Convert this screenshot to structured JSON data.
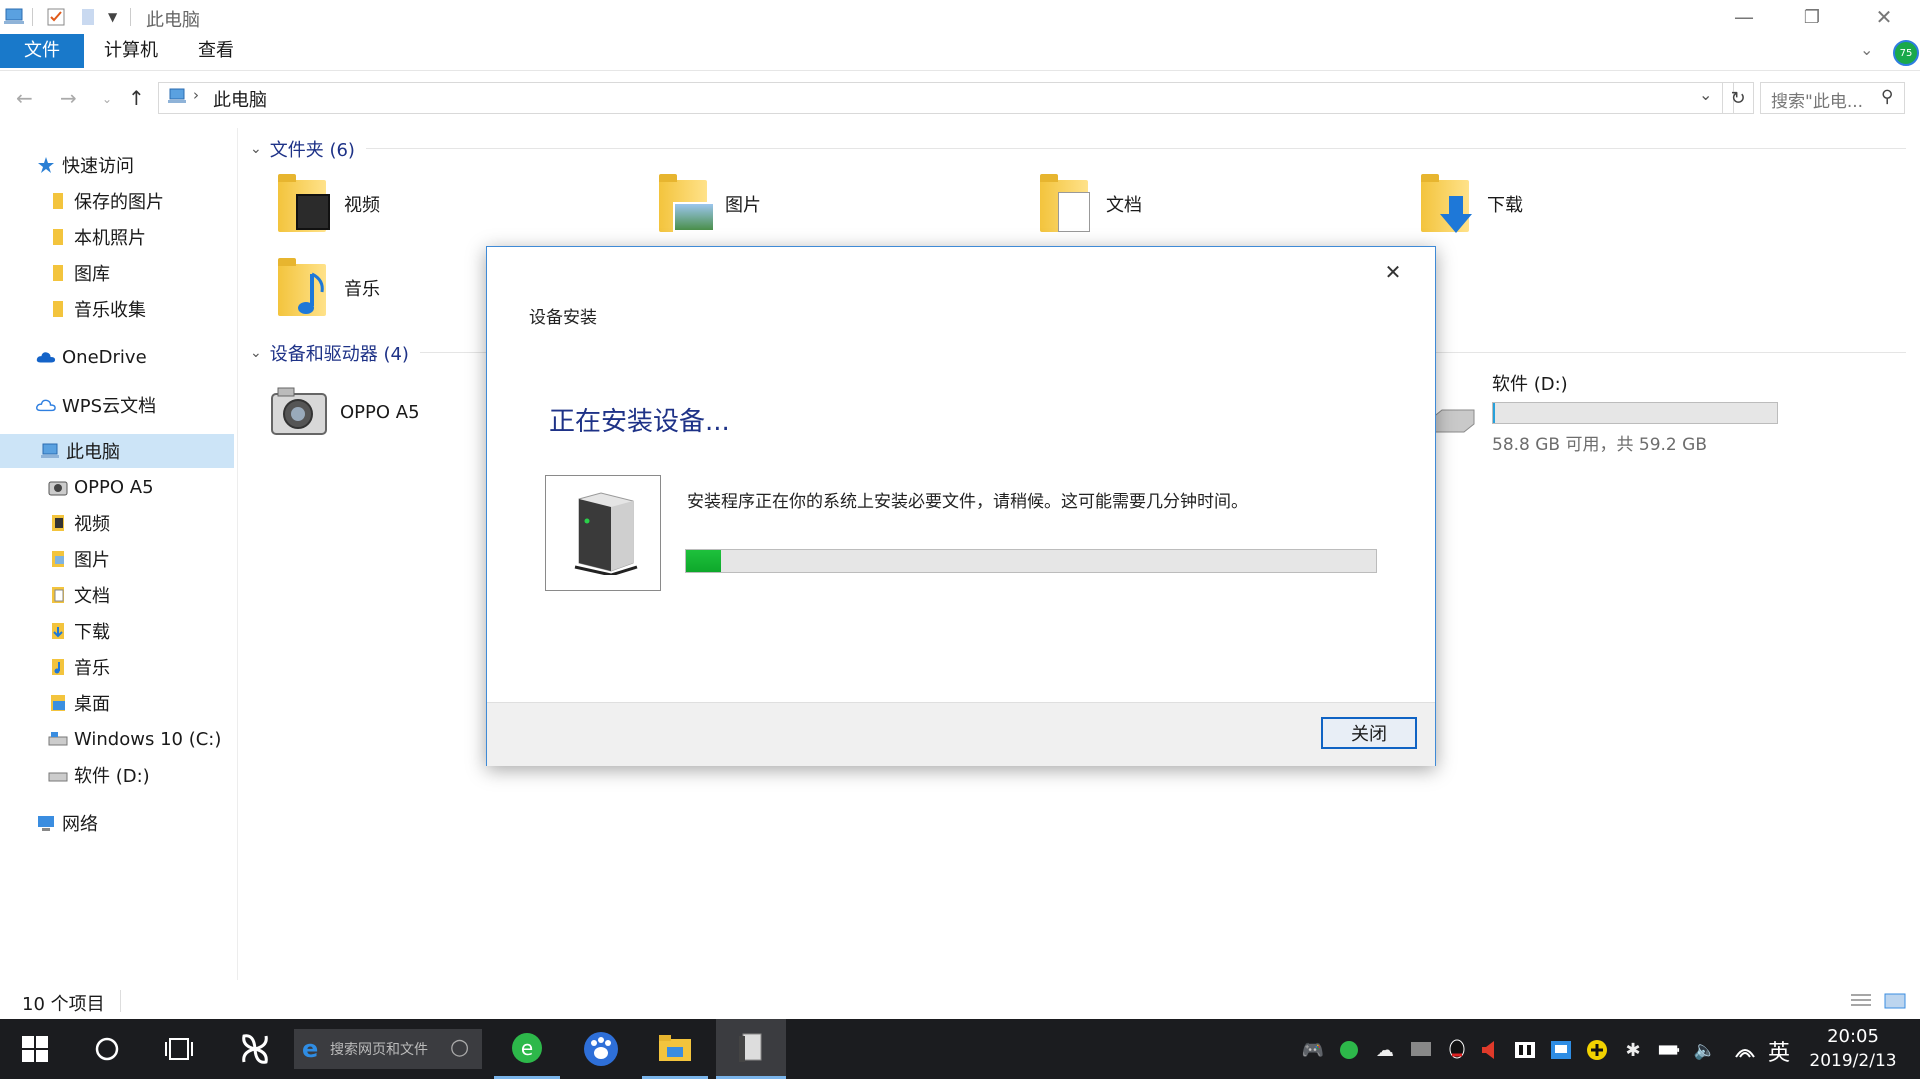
{
  "window": {
    "title": "此电脑",
    "minimize_label": "—",
    "restore_label": "❐",
    "close_label": "✕"
  },
  "ribbon": {
    "tabs": [
      {
        "label": "文件"
      },
      {
        "label": "计算机"
      },
      {
        "label": "查看"
      }
    ],
    "badge": "75"
  },
  "address": {
    "path_segments": [
      "此电脑"
    ],
    "search_placeholder": "搜索\"此电...",
    "refresh": "↻"
  },
  "nav_pane": {
    "items": [
      {
        "label": "快速访问",
        "icon": "star-icon"
      },
      {
        "label": "保存的图片",
        "icon": "folder-icon"
      },
      {
        "label": "本机照片",
        "icon": "folder-icon"
      },
      {
        "label": "图库",
        "icon": "folder-icon"
      },
      {
        "label": "音乐收集",
        "icon": "folder-icon"
      },
      {
        "label": "OneDrive",
        "icon": "onedrive-cloud-icon"
      },
      {
        "label": "WPS云文档",
        "icon": "wps-cloud-icon"
      },
      {
        "label": "此电脑",
        "icon": "this-pc-icon",
        "selected": true
      },
      {
        "label": "OPPO A5",
        "icon": "camera-icon"
      },
      {
        "label": "视频",
        "icon": "video-folder-icon"
      },
      {
        "label": "图片",
        "icon": "pictures-folder-icon"
      },
      {
        "label": "文档",
        "icon": "documents-folder-icon"
      },
      {
        "label": "下载",
        "icon": "downloads-folder-icon"
      },
      {
        "label": "音乐",
        "icon": "music-folder-icon"
      },
      {
        "label": "桌面",
        "icon": "desktop-folder-icon"
      },
      {
        "label": "Windows 10 (C:)",
        "icon": "drive-c-icon"
      },
      {
        "label": "软件 (D:)",
        "icon": "drive-d-icon"
      },
      {
        "label": "网络",
        "icon": "network-icon"
      }
    ]
  },
  "content": {
    "folders_header": "文件夹 (6)",
    "folders": [
      {
        "label": "视频"
      },
      {
        "label": "图片"
      },
      {
        "label": "文档"
      },
      {
        "label": "下载"
      },
      {
        "label": "音乐"
      }
    ],
    "devices_header": "设备和驱动器 (4)",
    "devices": [
      {
        "label": "OPPO A5"
      },
      {
        "label": "软件 (D:)",
        "free_text": "58.8 GB 可用，共 59.2 GB",
        "usage_fraction": 0.007
      }
    ]
  },
  "status_bar": {
    "item_count": "10 个项目"
  },
  "dialog": {
    "title": "设备安装",
    "heading": "正在安装设备...",
    "message": "安装程序正在你的系统上安装必要文件，请稍候。这可能需要几分钟时间。",
    "progress_fraction": 0.05,
    "close_button": "关闭",
    "close_x": "✕"
  },
  "taskbar": {
    "search_placeholder": "搜索网页和文件",
    "time": "20:05",
    "date": "2019/2/13",
    "ime": "英"
  },
  "colors": {
    "accent": "#1979ca",
    "taskbar": "#1b1c1f",
    "progress": "#1ec13c",
    "dialog_heading": "#1e3287"
  }
}
